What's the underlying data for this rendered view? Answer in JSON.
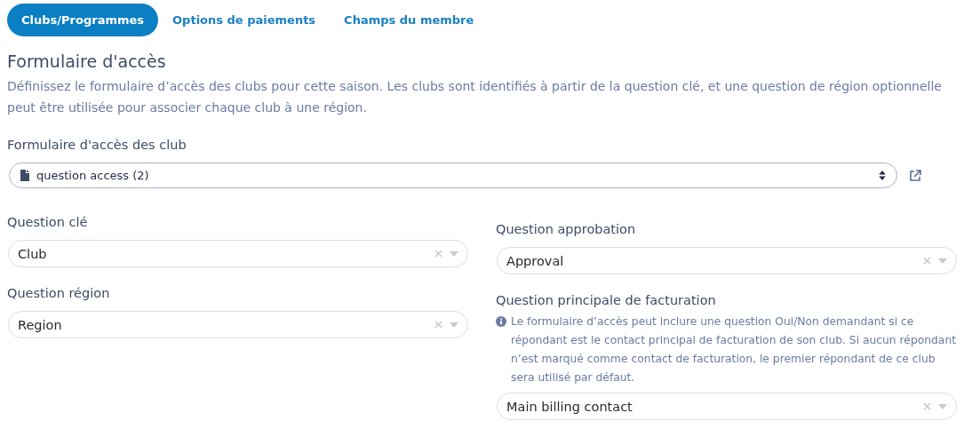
{
  "tabs": [
    {
      "label": "Clubs/Programmes",
      "selected": true
    },
    {
      "label": "Options de paiements",
      "selected": false
    },
    {
      "label": "Champs du membre",
      "selected": false
    }
  ],
  "section": {
    "title": "Formulaire d'accès",
    "description": "Définissez le formulaire d’accès des clubs pour cette saison. Les clubs sont identifiés à partir de la question clé, et une question de région optionnelle peut être utilisée pour associer chaque club à une région."
  },
  "form_select": {
    "label": "Formulaire d'accès des club",
    "value": "question access (2)"
  },
  "left_fields": [
    {
      "label": "Question clé",
      "value": "Club"
    },
    {
      "label": "Question région",
      "value": "Region"
    }
  ],
  "right_fields": [
    {
      "label": "Question approbation",
      "value": "Approval"
    },
    {
      "label": "Question principale de facturation",
      "hint": "Le formulaire d’accès peut inclure une question Oui/Non demandant si ce répondant est le contact principal de facturation de son club. Si aucun répondant n’est marqué comme contact de facturation, le premier répondant de ce club sera utilisé par défaut.",
      "value": "Main billing contact"
    }
  ]
}
